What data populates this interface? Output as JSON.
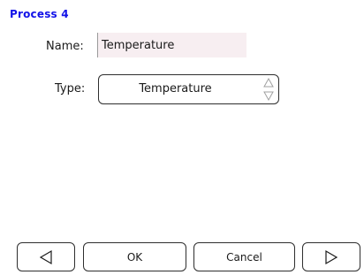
{
  "header": {
    "title": "Process 4"
  },
  "form": {
    "name_label": "Name:",
    "name_value": "Temperature",
    "type_label": "Type:",
    "type_value": "Temperature"
  },
  "footer": {
    "prev_icon": "triangle-left-icon",
    "ok_label": "OK",
    "cancel_label": "Cancel",
    "next_icon": "triangle-right-icon"
  },
  "colors": {
    "title": "#1212e8",
    "input_background": "#f7eef1",
    "border": "#2e2e2e"
  }
}
